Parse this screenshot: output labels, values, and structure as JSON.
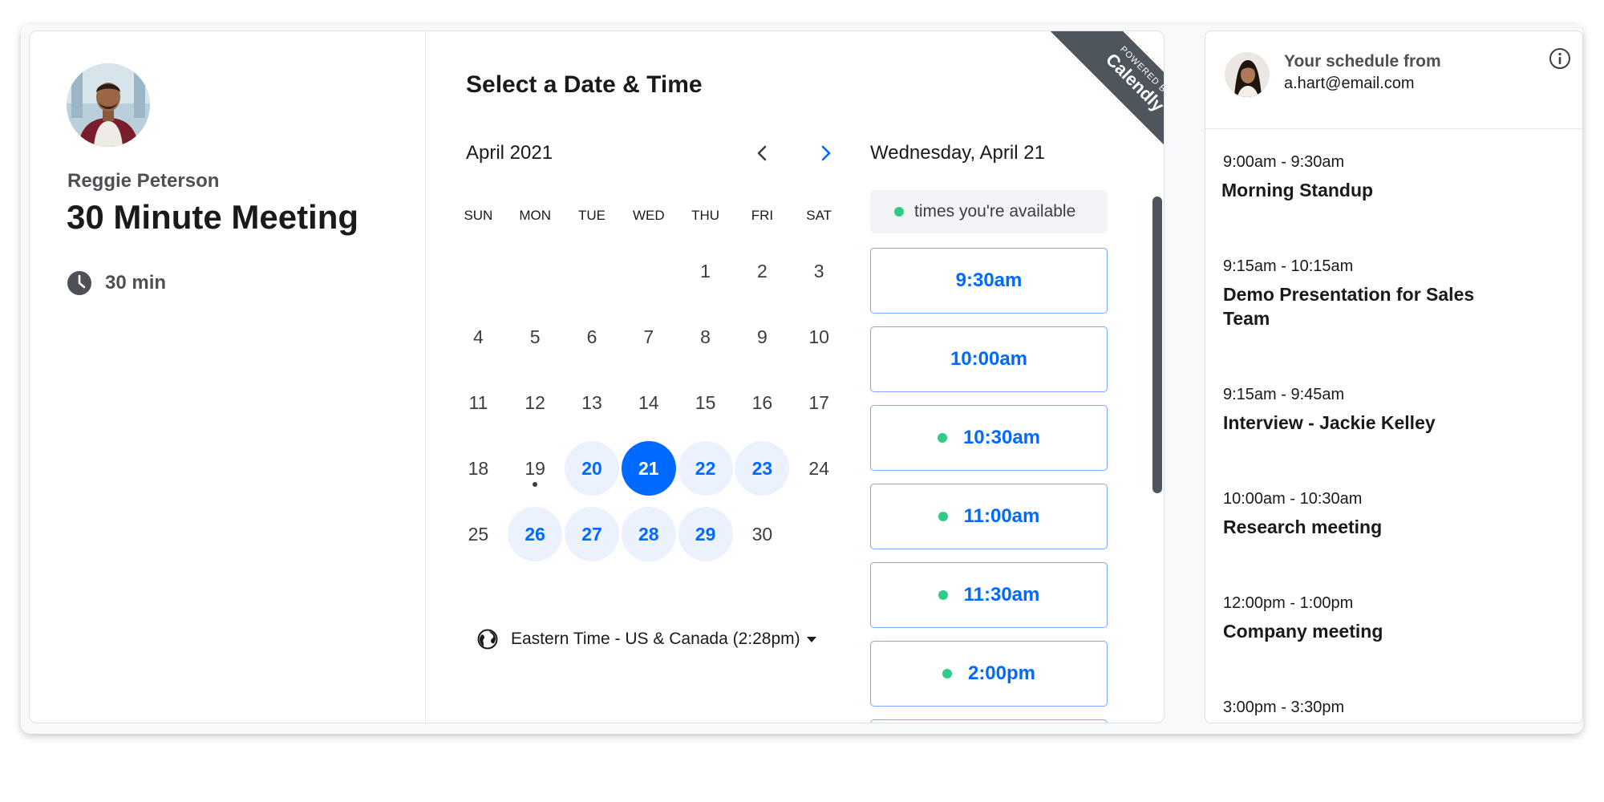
{
  "colors": {
    "accent": "#0069ff",
    "available_bg": "#ebf2fe",
    "available_dot": "#2ecc87",
    "ribbon": "#4f555c"
  },
  "host": {
    "name": "Reggie Peterson",
    "event_title": "30 Minute Meeting",
    "duration": "30 min",
    "duration_icon": "clock-icon"
  },
  "booking": {
    "title": "Select a Date & Time",
    "month": "April 2021",
    "prev_icon": "chevron-left-icon",
    "next_icon": "chevron-right-icon",
    "weekdays": [
      "SUN",
      "MON",
      "TUE",
      "WED",
      "THU",
      "FRI",
      "SAT"
    ],
    "days": [
      {
        "label": ""
      },
      {
        "label": ""
      },
      {
        "label": ""
      },
      {
        "label": ""
      },
      {
        "label": "1"
      },
      {
        "label": "2"
      },
      {
        "label": "3"
      },
      {
        "label": "4"
      },
      {
        "label": "5"
      },
      {
        "label": "6"
      },
      {
        "label": "7"
      },
      {
        "label": "8"
      },
      {
        "label": "9"
      },
      {
        "label": "10"
      },
      {
        "label": "11"
      },
      {
        "label": "12"
      },
      {
        "label": "13"
      },
      {
        "label": "14"
      },
      {
        "label": "15"
      },
      {
        "label": "16"
      },
      {
        "label": "17"
      },
      {
        "label": "18"
      },
      {
        "label": "19",
        "today": true
      },
      {
        "label": "20",
        "available": true
      },
      {
        "label": "21",
        "available": true,
        "selected": true
      },
      {
        "label": "22",
        "available": true
      },
      {
        "label": "23",
        "available": true
      },
      {
        "label": "24"
      },
      {
        "label": "25"
      },
      {
        "label": "26",
        "available": true
      },
      {
        "label": "27",
        "available": true
      },
      {
        "label": "28",
        "available": true
      },
      {
        "label": "29",
        "available": true
      },
      {
        "label": "30"
      }
    ],
    "timezone": "Eastern Time - US & Canada (2:28pm)",
    "timezone_icon": "globe-icon",
    "selected_date": "Wednesday, April 21",
    "legend": "times you're available",
    "slots": [
      {
        "time": "9:30am",
        "available_for_you": false
      },
      {
        "time": "10:00am",
        "available_for_you": false
      },
      {
        "time": "10:30am",
        "available_for_you": true
      },
      {
        "time": "11:00am",
        "available_for_you": true
      },
      {
        "time": "11:30am",
        "available_for_you": true
      },
      {
        "time": "2:00pm",
        "available_for_you": true
      }
    ],
    "ribbon_small": "POWERED BY",
    "ribbon_brand": "Calendly"
  },
  "schedule": {
    "title": "Your schedule from",
    "email": "a.hart@email.com",
    "info_icon": "info-icon",
    "events": [
      {
        "time": "9:00am - 9:30am",
        "title": "Morning Standup"
      },
      {
        "time": "9:15am - 10:15am",
        "title": "Demo Presentation for Sales Team"
      },
      {
        "time": "9:15am - 9:45am",
        "title": "Interview - Jackie Kelley"
      },
      {
        "time": "10:00am - 10:30am",
        "title": "Research meeting"
      },
      {
        "time": "12:00pm - 1:00pm",
        "title": "Company meeting"
      },
      {
        "time": "3:00pm - 3:30pm",
        "title": ""
      }
    ]
  }
}
